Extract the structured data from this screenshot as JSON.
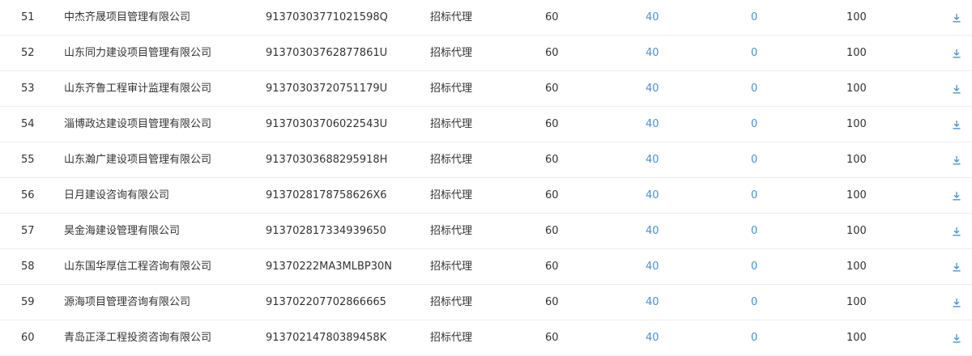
{
  "colors": {
    "link": "#4a8fd6",
    "text": "#333333",
    "divider": "#ebeef5"
  },
  "icons": {
    "download": "download-icon"
  },
  "rows": [
    {
      "index": "51",
      "name": "中杰齐晟项目管理有限公司",
      "code": "91370303771021598Q",
      "type": "招标代理",
      "score": "60",
      "a": "40",
      "b": "0",
      "total": "100"
    },
    {
      "index": "52",
      "name": "山东同力建设项目管理有限公司",
      "code": "91370303762877861U",
      "type": "招标代理",
      "score": "60",
      "a": "40",
      "b": "0",
      "total": "100"
    },
    {
      "index": "53",
      "name": "山东齐鲁工程审计监理有限公司",
      "code": "91370303720751179U",
      "type": "招标代理",
      "score": "60",
      "a": "40",
      "b": "0",
      "total": "100"
    },
    {
      "index": "54",
      "name": "淄博政达建设项目管理有限公司",
      "code": "91370303706022543U",
      "type": "招标代理",
      "score": "60",
      "a": "40",
      "b": "0",
      "total": "100"
    },
    {
      "index": "55",
      "name": "山东瀚广建设项目管理有限公司",
      "code": "91370303688295918H",
      "type": "招标代理",
      "score": "60",
      "a": "40",
      "b": "0",
      "total": "100"
    },
    {
      "index": "56",
      "name": "日月建设咨询有限公司",
      "code": "9137028178758626X6",
      "type": "招标代理",
      "score": "60",
      "a": "40",
      "b": "0",
      "total": "100"
    },
    {
      "index": "57",
      "name": "昊金海建设管理有限公司",
      "code": "913702817334939650",
      "type": "招标代理",
      "score": "60",
      "a": "40",
      "b": "0",
      "total": "100"
    },
    {
      "index": "58",
      "name": "山东国华厚信工程咨询有限公司",
      "code": "91370222MA3MLBP30N",
      "type": "招标代理",
      "score": "60",
      "a": "40",
      "b": "0",
      "total": "100"
    },
    {
      "index": "59",
      "name": "源海项目管理咨询有限公司",
      "code": "913702207702866665",
      "type": "招标代理",
      "score": "60",
      "a": "40",
      "b": "0",
      "total": "100"
    },
    {
      "index": "60",
      "name": "青岛正泽工程投资咨询有限公司",
      "code": "91370214780389458K",
      "type": "招标代理",
      "score": "60",
      "a": "40",
      "b": "0",
      "total": "100"
    }
  ]
}
